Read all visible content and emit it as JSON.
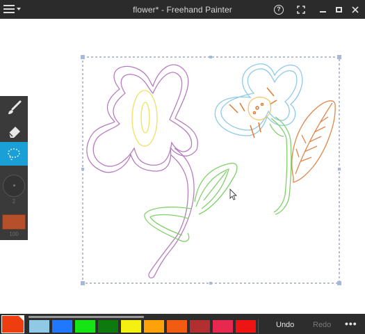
{
  "window": {
    "title": "flower* - Freehand Painter",
    "menu_icon": "hamburger-menu-icon",
    "help_glyph": "?",
    "controls": [
      "help-icon",
      "fullscreen-icon",
      "minimize-icon",
      "maximize-icon",
      "close-icon"
    ]
  },
  "tools": {
    "brush_icon": "paintbrush-icon",
    "eraser_icon": "eraser-icon",
    "select_icon": "lasso-select-icon",
    "brush_size": "2",
    "opacity": "100",
    "current_color": "#b5502a",
    "active_tool": "select",
    "accent_color": "#1aa0d6"
  },
  "palette": {
    "selected_color": "#ee3e0f",
    "colors": [
      "#8ecae6",
      "#1f78ff",
      "#15e415",
      "#0c7a0c",
      "#f4f012",
      "#ffa20a",
      "#f25c12",
      "#b22f2f",
      "#e8284e",
      "#ee1414"
    ],
    "undo_label": "Undo",
    "redo_label": "Redo",
    "more_label": "•••"
  },
  "canvas": {
    "selection": "dashed-rectangle",
    "cursor": "arrow-cursor-icon"
  }
}
